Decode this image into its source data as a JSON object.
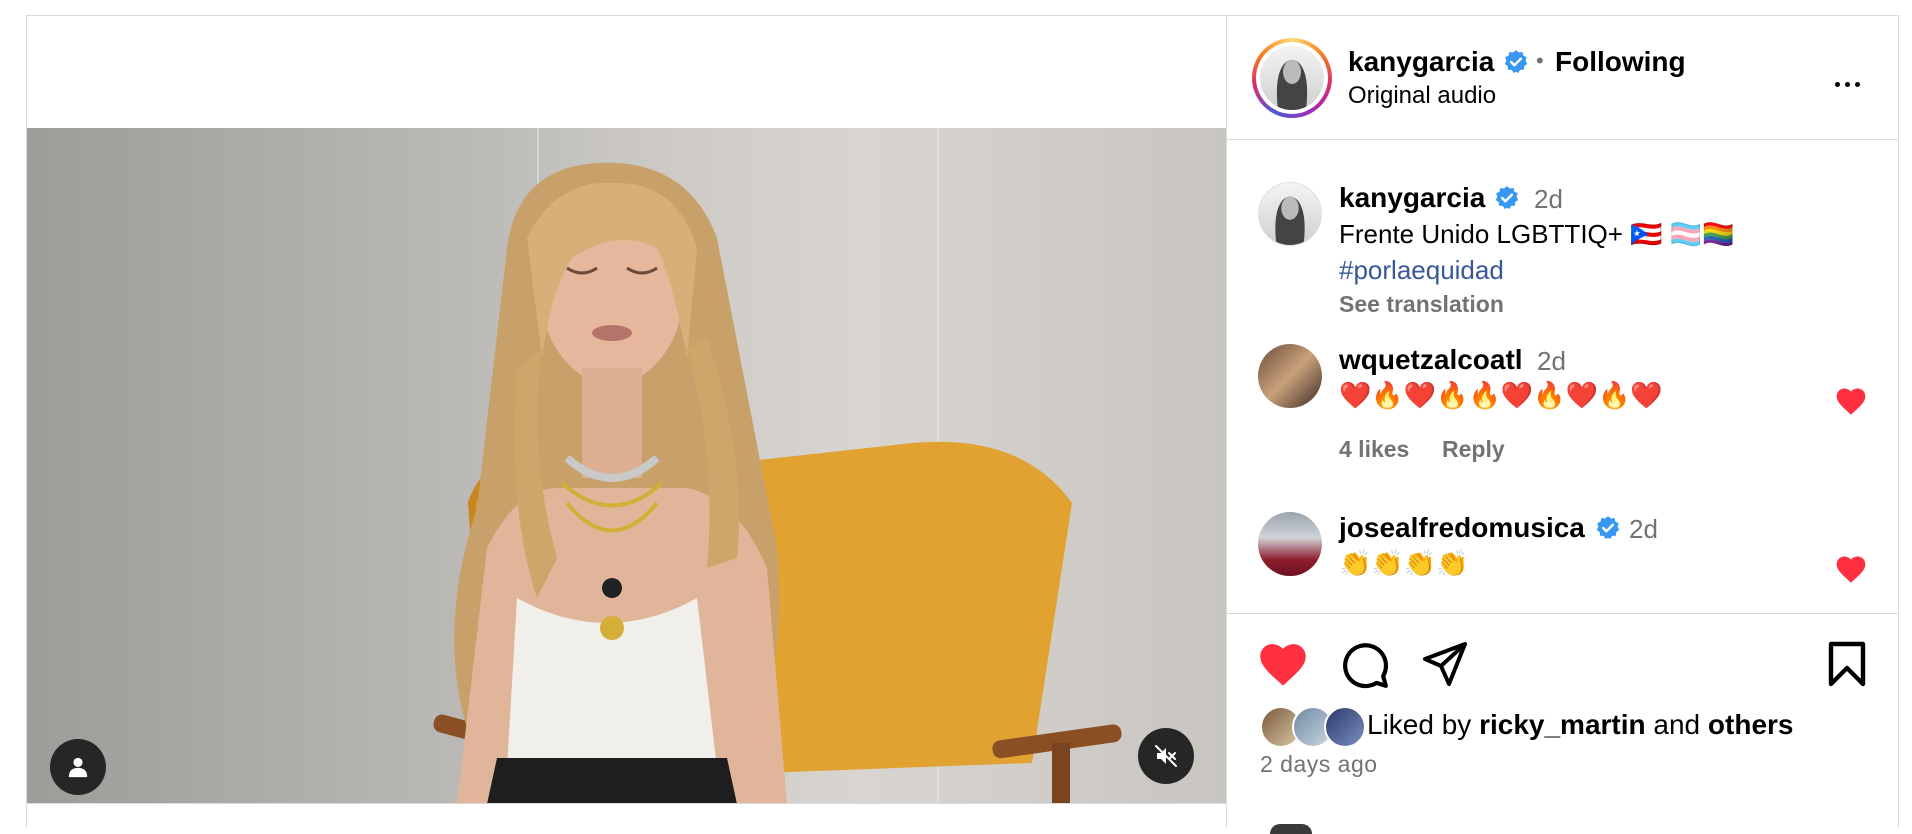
{
  "header": {
    "username": "kanygarcia",
    "separator": "•",
    "follow_status": "Following",
    "audio_label": "Original audio"
  },
  "caption": {
    "username": "kanygarcia",
    "time": "2d",
    "text": "Frente Unido LGBTTIQ+ 🇵🇷 🏳️‍⚧️🏳️‍🌈",
    "hashtag": "#porlaequidad",
    "see_translation": "See translation"
  },
  "comments": [
    {
      "username": "wquetzalcoatl",
      "time": "2d",
      "text": "❤️🔥❤️🔥🔥❤️🔥❤️🔥❤️",
      "likes": "4 likes",
      "reply": "Reply"
    },
    {
      "username": "josealfredomusica",
      "time": "2d",
      "text": "👏👏👏👏"
    }
  ],
  "actions": {
    "liked_prefix": "Liked by",
    "liked_user": "ricky_martin",
    "liked_and": "and",
    "liked_others": "others",
    "posted_ago": "2 days ago"
  },
  "colors": {
    "like_red": "#ff3040",
    "verified_blue": "#3897f0",
    "link_blue": "#385898",
    "secondary_gray": "#737373",
    "chair_yellow": "#e6a52e"
  },
  "icons": {
    "user_tag": "person-icon",
    "mute": "muted-speaker-icon",
    "more": "ellipsis-icon",
    "like": "heart-icon",
    "comment": "comment-bubble-icon",
    "share": "paper-plane-icon",
    "save": "bookmark-icon"
  }
}
